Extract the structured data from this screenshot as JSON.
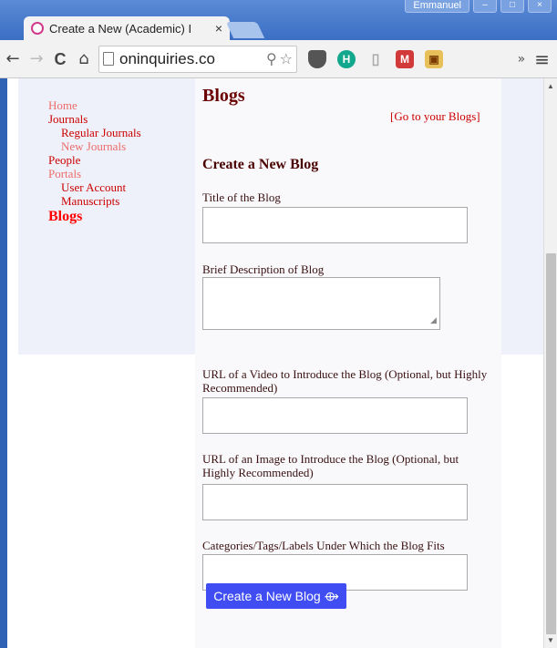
{
  "window": {
    "user": "Emmanuel",
    "controls": [
      "–",
      "□",
      "×"
    ]
  },
  "tab": {
    "title": "Create a New (Academic) I",
    "close": "×"
  },
  "toolbar": {
    "back": "←",
    "forward": "→",
    "reload": "C",
    "home": "⌂",
    "url": "oninquiries.co",
    "zoom_icon": "⚲",
    "star_icon": "☆",
    "ext_h": "H",
    "ext_usb": "▯",
    "ext_mv": "M",
    "ext_bag": "▣",
    "overflow": "»",
    "menu": "≡"
  },
  "sidebar": {
    "items": [
      {
        "label": "Home",
        "level": 1,
        "color": "#ee6b6b"
      },
      {
        "label": "Journals",
        "level": 1,
        "color": "#cc0000"
      },
      {
        "label": "Regular Journals",
        "level": 2,
        "color": "#cc0000"
      },
      {
        "label": "New Journals",
        "level": 2,
        "color": "#ee6b6b"
      },
      {
        "label": "People",
        "level": 1,
        "color": "#cc0000"
      },
      {
        "label": "Portals",
        "level": 1,
        "color": "#ee6b6b"
      },
      {
        "label": "User Account",
        "level": 2,
        "color": "#cc0000"
      },
      {
        "label": "Manuscripts",
        "level": 2,
        "color": "#cc0000"
      },
      {
        "label": "Blogs",
        "level": 1,
        "color": "#ff0000",
        "active": true
      }
    ]
  },
  "main": {
    "title": "Blogs",
    "go_link": "[Go to your Blogs]",
    "section_title": "Create a New Blog",
    "fields": {
      "title_label": "Title of the Blog",
      "title_value": "",
      "description_label": "Brief Description of Blog",
      "description_value": "",
      "video_label": "URL of a Video to Introduce the Blog (Optional, but Highly Recommended)",
      "video_value": "",
      "image_label": "URL of an Image to Introduce the Blog (Optional, but Highly Recommended)",
      "image_value": "",
      "categories_label": "Categories/Tags/Labels Under Which the Blog Fits",
      "categories_value": ""
    },
    "submit_label": "Create a New Blog ⟴"
  }
}
